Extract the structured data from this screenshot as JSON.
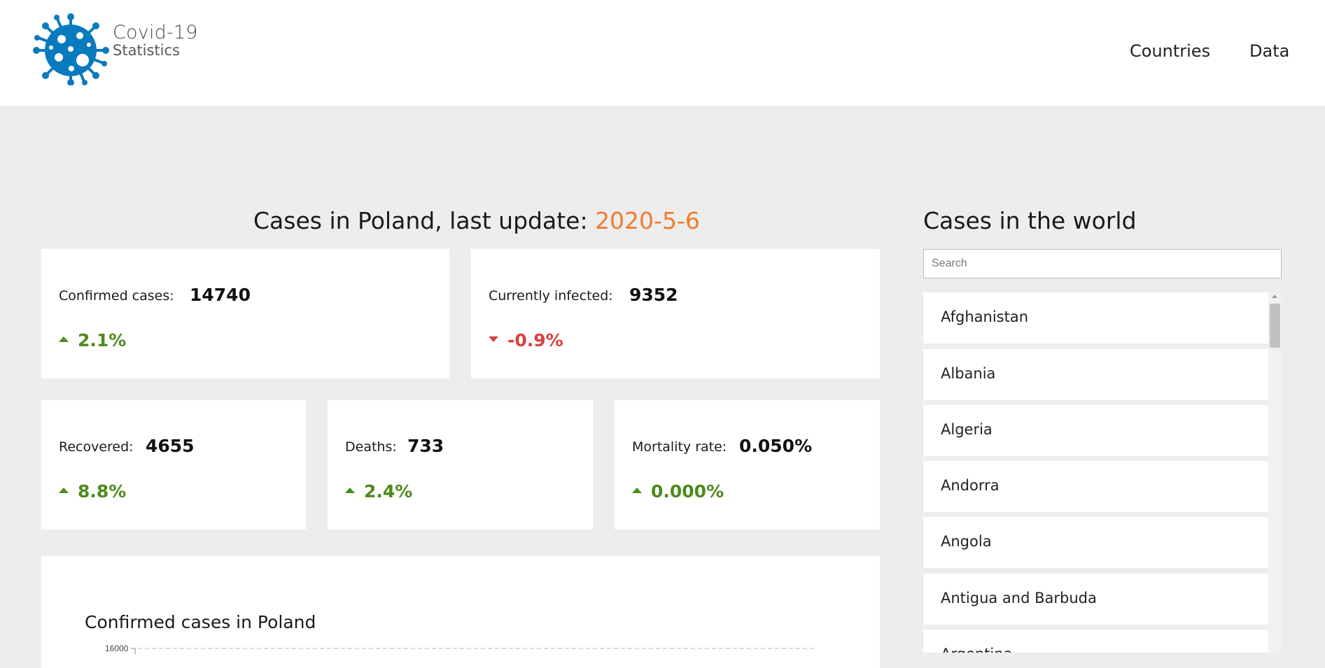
{
  "header": {
    "logo_title": "Covid-19",
    "logo_subtitle": "Statistics",
    "logo_icon": "virus-icon",
    "nav": [
      {
        "label": "Countries"
      },
      {
        "label": "Data"
      }
    ]
  },
  "poland": {
    "title_prefix": "Cases in Poland, last update: ",
    "date": "2020-5-6",
    "cards": [
      {
        "label": "Confirmed cases:",
        "value": "14740",
        "change": "2.1%",
        "trend": "up"
      },
      {
        "label": "Currently infected:",
        "value": "9352",
        "change": "-0.9%",
        "trend": "down"
      },
      {
        "label": "Recovered:",
        "value": "4655",
        "change": "8.8%",
        "trend": "up"
      },
      {
        "label": "Deaths:",
        "value": "733",
        "change": "2.4%",
        "trend": "up"
      },
      {
        "label": "Mortality rate:",
        "value": "0.050%",
        "change": "0.000%",
        "trend": "up"
      }
    ]
  },
  "world": {
    "title": "Cases in the world",
    "search_placeholder": "Search",
    "countries": [
      "Afghanistan",
      "Albania",
      "Algeria",
      "Andorra",
      "Angola",
      "Antigua and Barbuda",
      "Argentina"
    ]
  },
  "chart": {
    "title": "Confirmed cases in Poland",
    "y_top_tick": "16000"
  },
  "colors": {
    "accent_date": "#ef7b2f",
    "trend_up": "#4e8a1c",
    "trend_down": "#d94040",
    "logo": "#0a7abf"
  }
}
